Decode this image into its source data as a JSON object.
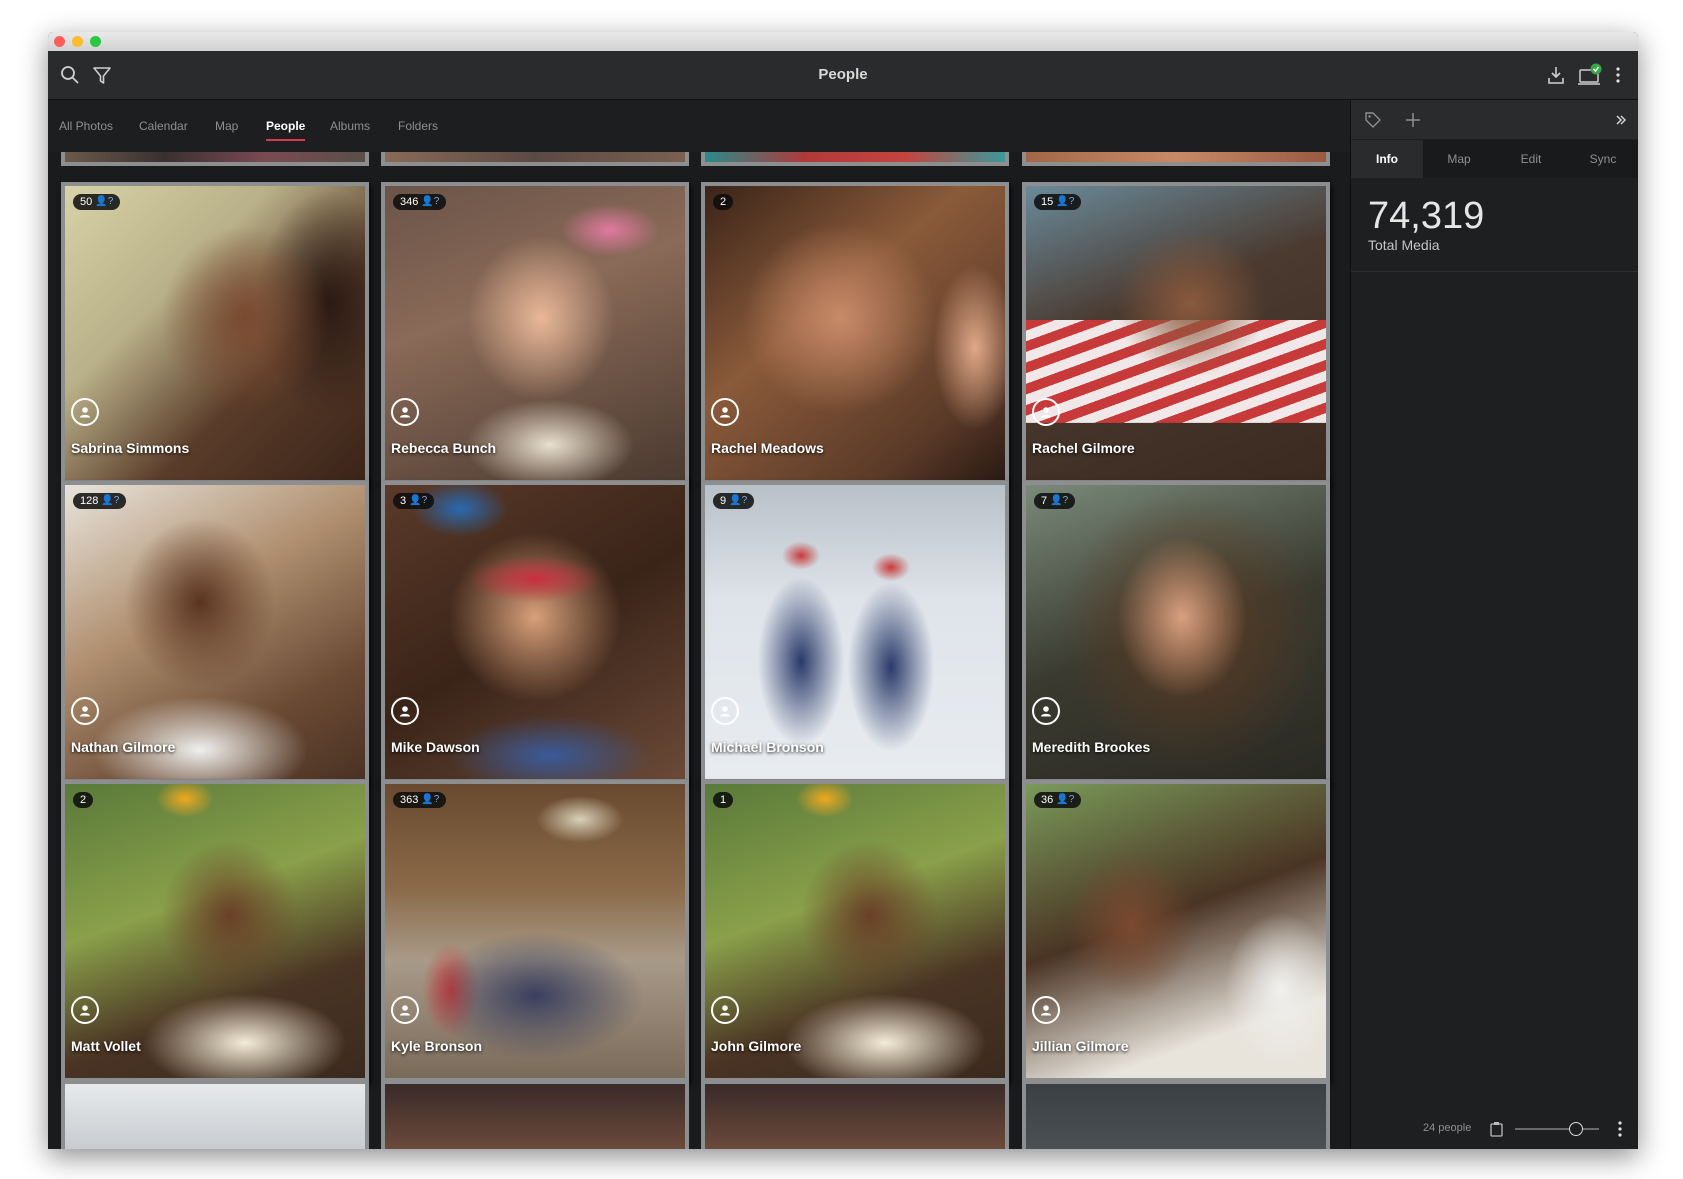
{
  "app": {
    "title": "People"
  },
  "nav": {
    "tabs": [
      "All Photos",
      "Calendar",
      "Map",
      "People",
      "Albums",
      "Folders"
    ],
    "active": "People"
  },
  "side": {
    "tabs": [
      "Info",
      "Map",
      "Edit",
      "Sync"
    ],
    "active": "Info",
    "total_media_value": "74,319",
    "total_media_label": "Total Media",
    "people_count": "24 people",
    "zoom_level": 0.75
  },
  "colors": {
    "accent": "#d63a52",
    "sync_badge": "#3aa84a",
    "badge_icon": "#7fa8e8"
  },
  "icons": [
    "search-icon",
    "filter-icon",
    "download-icon",
    "computer-sync-icon",
    "more-icon",
    "tag-icon",
    "plus-icon",
    "expand-icon",
    "clipboard-icon"
  ],
  "people": [
    {
      "name": "Sabrina Simmons",
      "count": "50",
      "unknown": true
    },
    {
      "name": "Rebecca Bunch",
      "count": "346",
      "unknown": true
    },
    {
      "name": "Rachel Meadows",
      "count": "2",
      "unknown": false
    },
    {
      "name": "Rachel Gilmore",
      "count": "15",
      "unknown": true
    },
    {
      "name": "Nathan Gilmore",
      "count": "128",
      "unknown": true
    },
    {
      "name": "Mike Dawson",
      "count": "3",
      "unknown": true
    },
    {
      "name": "Michael Bronson",
      "count": "9",
      "unknown": true
    },
    {
      "name": "Meredith Brookes",
      "count": "7",
      "unknown": true
    },
    {
      "name": "Matt Vollet",
      "count": "2",
      "unknown": false
    },
    {
      "name": "Kyle Bronson",
      "count": "363",
      "unknown": true
    },
    {
      "name": "John Gilmore",
      "count": "1",
      "unknown": false
    },
    {
      "name": "Jillian Gilmore",
      "count": "36",
      "unknown": true
    }
  ]
}
